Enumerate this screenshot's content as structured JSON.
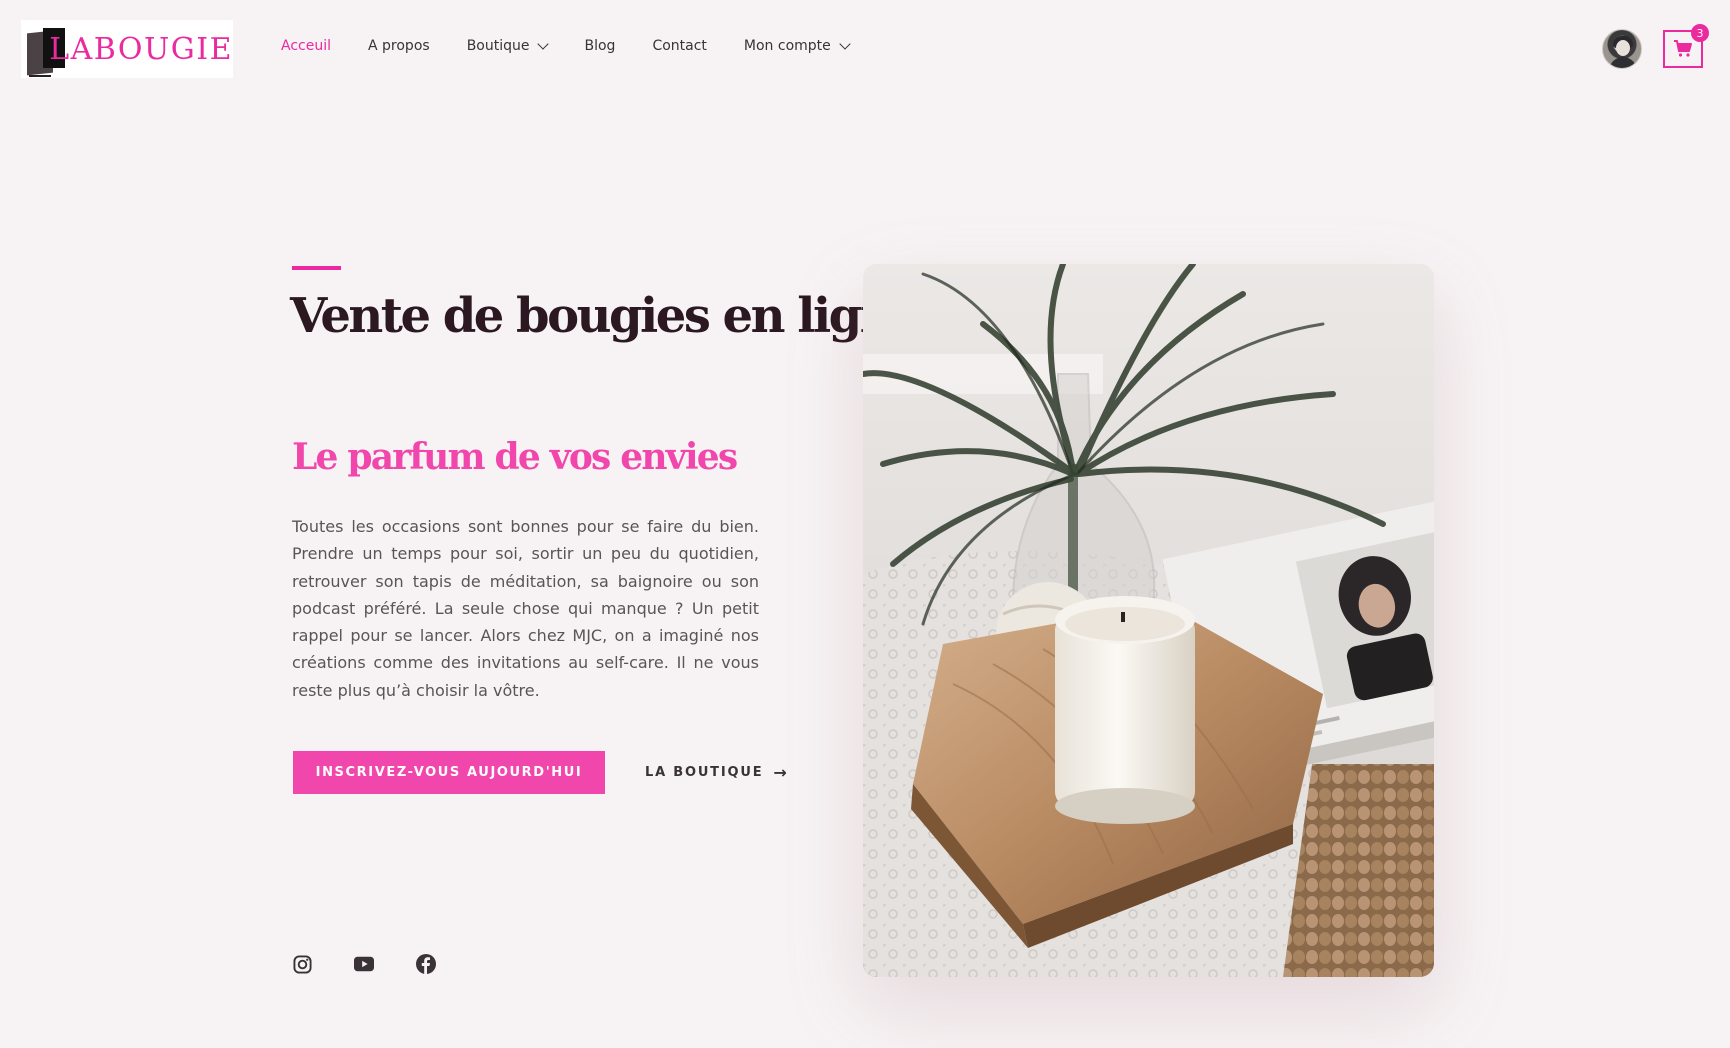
{
  "brand": {
    "logo_text": "LABOUGIE"
  },
  "nav": {
    "items": [
      {
        "label": "Acceuil",
        "active": true
      },
      {
        "label": "A propos",
        "active": false
      },
      {
        "label": "Boutique",
        "active": false,
        "has_dropdown": true
      },
      {
        "label": "Blog",
        "active": false
      },
      {
        "label": "Contact",
        "active": false
      },
      {
        "label": "Mon compte",
        "active": false,
        "has_dropdown": true
      }
    ]
  },
  "header_actions": {
    "avatar_icon": "user-avatar",
    "cart_icon": "shopping-cart-icon",
    "cart_count": "3"
  },
  "hero": {
    "title": "Vente de bougies en ligne",
    "subtitle": "Le parfum de vos envies",
    "text": "Toutes les occasions sont bonnes pour se faire du bien. Prendre un temps pour soi, sortir un peu du quotidien, retrouver son tapis de méditation, sa baignoire ou son podcast préféré. La seule chose qui manque ? Un petit rappel pour se lancer. Alors chez MJC, on a imaginé nos créations comme des invitations au self-care. Il ne vous reste plus qu’à choisir la vôtre.",
    "cta_primary": "INSCRIVEZ-VOUS AUJOURD'HUI",
    "cta_secondary": "LA BOUTIQUE",
    "cta_secondary_icon": "arrow-right-icon"
  },
  "social": [
    {
      "icon": "instagram-icon"
    },
    {
      "icon": "youtube-icon"
    },
    {
      "icon": "facebook-icon"
    }
  ],
  "colors": {
    "accent": "#f147ad",
    "title": "#2b1820",
    "background": "#f7f3f4",
    "text": "#5a5458"
  }
}
